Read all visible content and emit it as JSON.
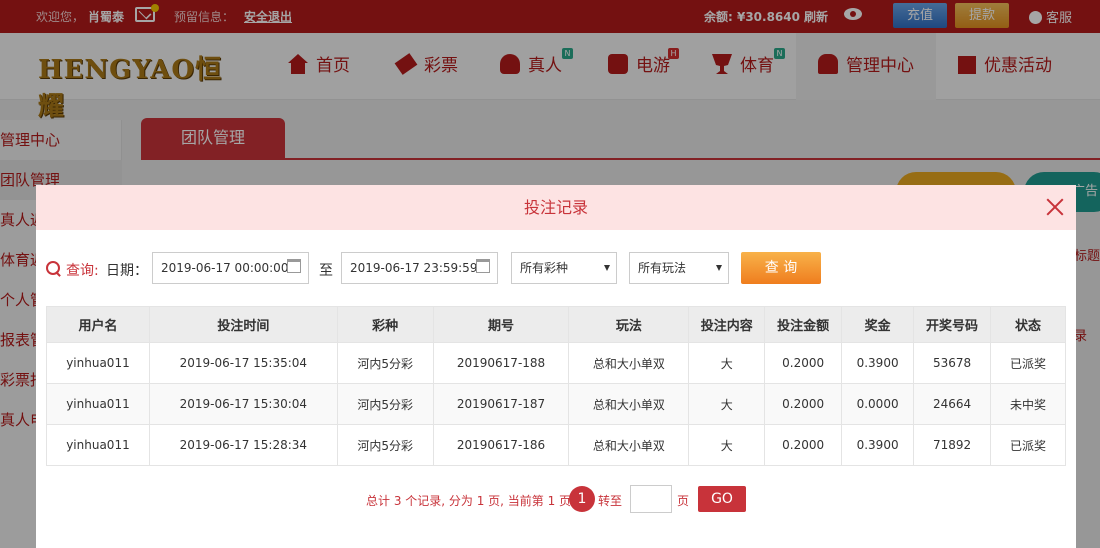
{
  "topbar": {
    "welcome": "欢迎您，",
    "username": "肖蜀泰",
    "warning": "预留信息：",
    "logout": "安全退出",
    "balance": "余额: ¥30.8640",
    "refresh": "刷新",
    "recharge": "充值",
    "withdraw": "提款",
    "service": "客服"
  },
  "logo": {
    "text": "HENGYAO恒耀"
  },
  "nav": {
    "items": [
      {
        "label": "首页"
      },
      {
        "label": "彩票"
      },
      {
        "label": "真人",
        "badge": "N"
      },
      {
        "label": "电游",
        "badge": "H"
      },
      {
        "label": "体育",
        "badge": "N"
      },
      {
        "label": "管理中心"
      },
      {
        "label": "优惠活动"
      }
    ]
  },
  "sidebar": {
    "items": [
      {
        "label": "管理中心"
      },
      {
        "label": "团队管理"
      },
      {
        "label": "真人返"
      },
      {
        "label": "体育返"
      },
      {
        "label": "个人管"
      },
      {
        "label": "报表管"
      },
      {
        "label": "彩票报"
      },
      {
        "label": "真人电"
      }
    ]
  },
  "content": {
    "tab": "团队管理",
    "right_pill": "广告",
    "right_text1": "标题",
    "right_text2": "录"
  },
  "modal": {
    "title": "投注记录",
    "query_label": "查询:",
    "date_label": "日期：",
    "start_date": "2019-06-17 00:00:00",
    "to_label": "至",
    "end_date": "2019-06-17 23:59:59",
    "lottery_select": "所有彩种",
    "play_select": "所有玩法",
    "query_button": "查 询",
    "table": {
      "headers": [
        "用户名",
        "投注时间",
        "彩种",
        "期号",
        "玩法",
        "投注内容",
        "投注金额",
        "奖金",
        "开奖号码",
        "状态"
      ],
      "rows": [
        [
          "yinhua011",
          "2019-06-17 15:35:04",
          "河内5分彩",
          "20190617-188",
          "总和大小单双",
          "大",
          "0.2000",
          "0.3900",
          "53678",
          "已派奖"
        ],
        [
          "yinhua011",
          "2019-06-17 15:30:04",
          "河内5分彩",
          "20190617-187",
          "总和大小单双",
          "大",
          "0.2000",
          "0.0000",
          "24664",
          "未中奖"
        ],
        [
          "yinhua011",
          "2019-06-17 15:28:34",
          "河内5分彩",
          "20190617-186",
          "总和大小单双",
          "大",
          "0.2000",
          "0.3900",
          "71892",
          "已派奖"
        ]
      ]
    },
    "pager": {
      "summary": "总计 3 个记录, 分为 1 页, 当前第 1 页",
      "current_page": "1",
      "goto_label": "转至",
      "page_label": "页",
      "go_button": "GO"
    }
  },
  "colors": {
    "brand_red": "#b21b1b",
    "accent_red": "#c8333a",
    "modal_header": "#fde3e3",
    "query_orange": "#ef7d1e"
  }
}
